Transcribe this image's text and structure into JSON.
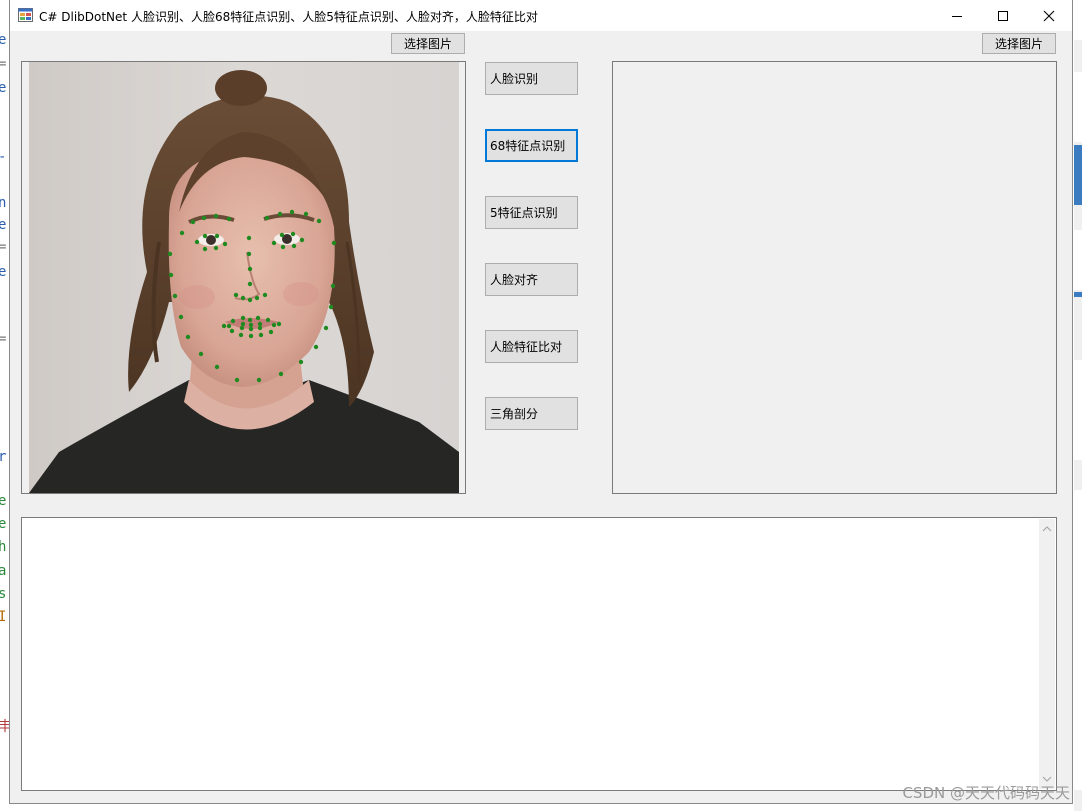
{
  "window": {
    "title": "C# DlibDotNet 人脸识别、人脸68特征点识别、人脸5特征点识别、人脸对齐，人脸特征比对"
  },
  "left_panel": {
    "select_button": "选择图片"
  },
  "right_panel": {
    "select_button": "选择图片"
  },
  "actions": [
    {
      "label": "人脸识别"
    },
    {
      "label": "68特征点识别"
    },
    {
      "label": "5特征点识别"
    },
    {
      "label": "人脸对齐"
    },
    {
      "label": "人脸特征比对"
    },
    {
      "label": "三角剖分"
    }
  ],
  "output": {
    "text": ""
  },
  "watermark": "CSDN @天天代码码天天",
  "colors": {
    "landmark": "#1f8a1f",
    "focus_border": "#0078d7",
    "form_bg": "#f0f0f0"
  },
  "icons": [
    "app-icon",
    "minimize-icon",
    "maximize-icon",
    "close-icon"
  ]
}
